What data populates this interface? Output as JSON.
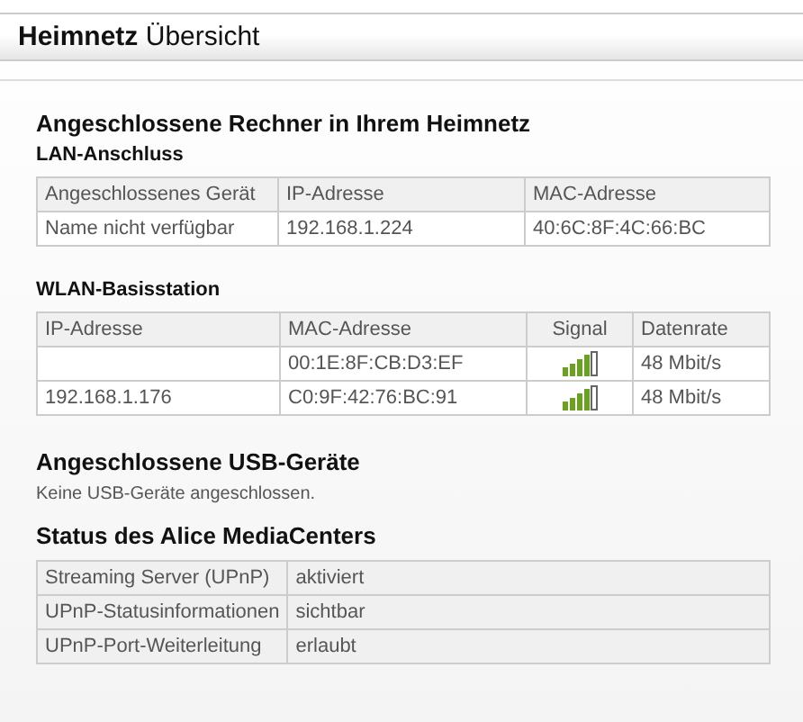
{
  "page_title": "**Heimnetz** Übersicht",
  "computers": {
    "heading": "Angeschlossene Rechner in Ihrem Heimnetz",
    "lan": {
      "heading": "LAN-Anschluss",
      "columns": [
        "Angeschlossenes Gerät",
        "IP-Adresse",
        "MAC-Adresse"
      ],
      "rows": [
        [
          "Name nicht verfügbar",
          "192.168.1.224",
          "40:6C:8F:4C:66:BC"
        ]
      ]
    },
    "wlan": {
      "heading": "WLAN-Basisstation",
      "columns": [
        "IP-Adresse",
        "MAC-Adresse",
        "Signal",
        "Datenrate"
      ],
      "rows": [
        {
          "ip": "",
          "mac": "00:1E:8F:CB:D3:EF",
          "rate": "48 Mbit/s"
        },
        {
          "ip": "192.168.1.176",
          "mac": "C0:9F:42:76:BC:91",
          "rate": "48 Mbit/s"
        }
      ]
    }
  },
  "usb": {
    "heading": "Angeschlossene USB-Geräte",
    "text": "Keine USB-Geräte angeschlossen."
  },
  "mediacenter": {
    "heading": "Status des Alice MediaCenters",
    "rows": [
      [
        "Streaming Server (UPnP)",
        "aktiviert"
      ],
      [
        "UPnP-Statusinformationen",
        "sichtbar"
      ],
      [
        "UPnP-Port-Weiterleitung",
        "erlaubt"
      ]
    ]
  }
}
